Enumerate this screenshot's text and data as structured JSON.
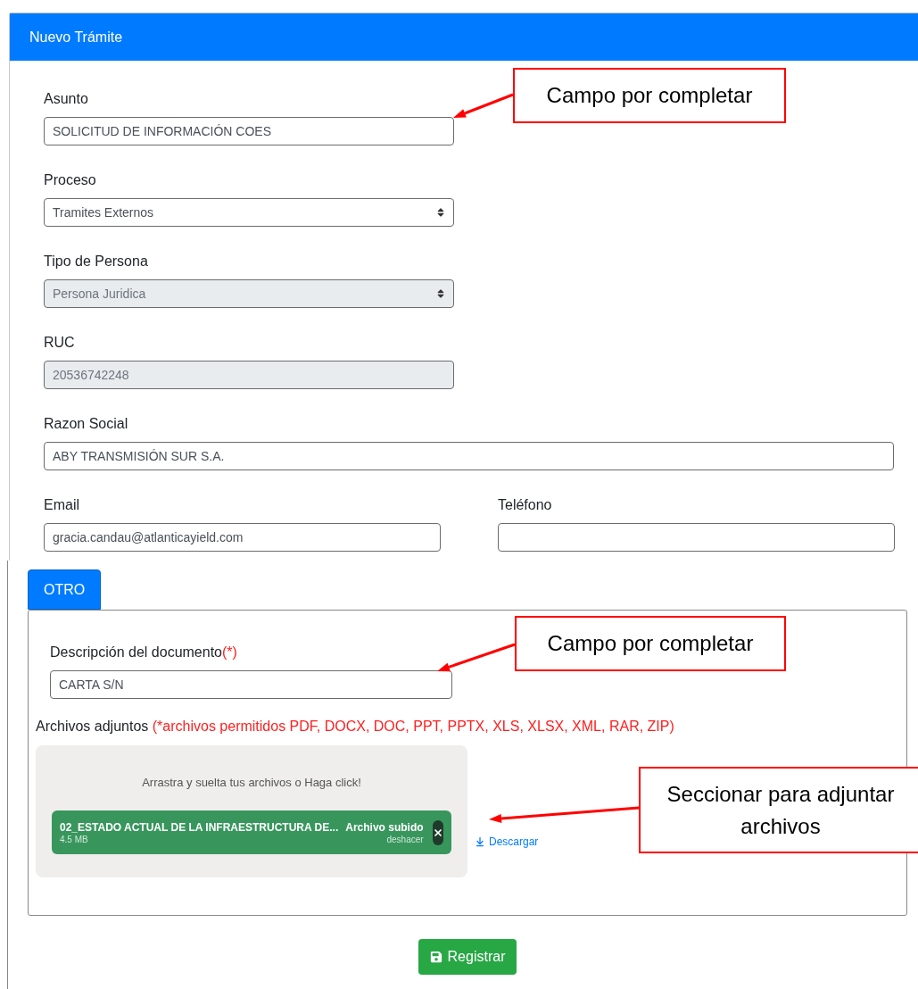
{
  "panel": {
    "title": "Nuevo Trámite"
  },
  "rows": [
    [
      {
        "label": "Asunto",
        "kind": "text",
        "value": "SOLICITUD DE INFORMACIÓN COES",
        "disabled": false
      }
    ],
    [
      {
        "label": "Proceso",
        "kind": "select",
        "value": "Tramites Externos",
        "disabled": false
      }
    ],
    [
      {
        "label": "Tipo de Persona",
        "kind": "select",
        "value": "Persona Juridica",
        "disabled": true
      }
    ],
    [
      {
        "label": "RUC",
        "kind": "text",
        "value": "20536742248",
        "disabled": true
      }
    ],
    [
      {
        "label": "Razon Social",
        "kind": "text",
        "value": "ABY TRANSMISIÓN SUR S.A.",
        "disabled": false
      }
    ],
    [
      {
        "label": "Email",
        "kind": "text",
        "value": "gracia.candau@atlanticayield.com",
        "disabled": false
      },
      {
        "label": "Teléfono",
        "kind": "text",
        "disabled": false
      }
    ]
  ],
  "tabs": [
    {
      "label": "OTRO",
      "selected": true
    }
  ],
  "document": {
    "description_label": "Descripción del documento",
    "required_mark": "(*)",
    "description_value": "CARTA S/N",
    "attachments_label": "Archivos adjuntos",
    "attachments_note": "(*archivos permitidos PDF, DOCX, DOC, PPT, PPTX, XLS, XLSX, XML, RAR, ZIP)",
    "dropzone_text": "Arrastra y suelta tus archivos o Haga click!",
    "files": [
      {
        "name": "02_ESTADO ACTUAL DE LA INFRAESTRUCTURA DE...",
        "size": "4.5 MB",
        "status": "Archivo subido",
        "undo": "deshacer"
      }
    ],
    "download_link": "Descargar"
  },
  "submit": "Registrar",
  "callouts": [
    {
      "text": "Campo por completar"
    },
    {
      "text": "Campo por completar"
    },
    {
      "text": "Seccionar para adjuntar archivos"
    }
  ]
}
